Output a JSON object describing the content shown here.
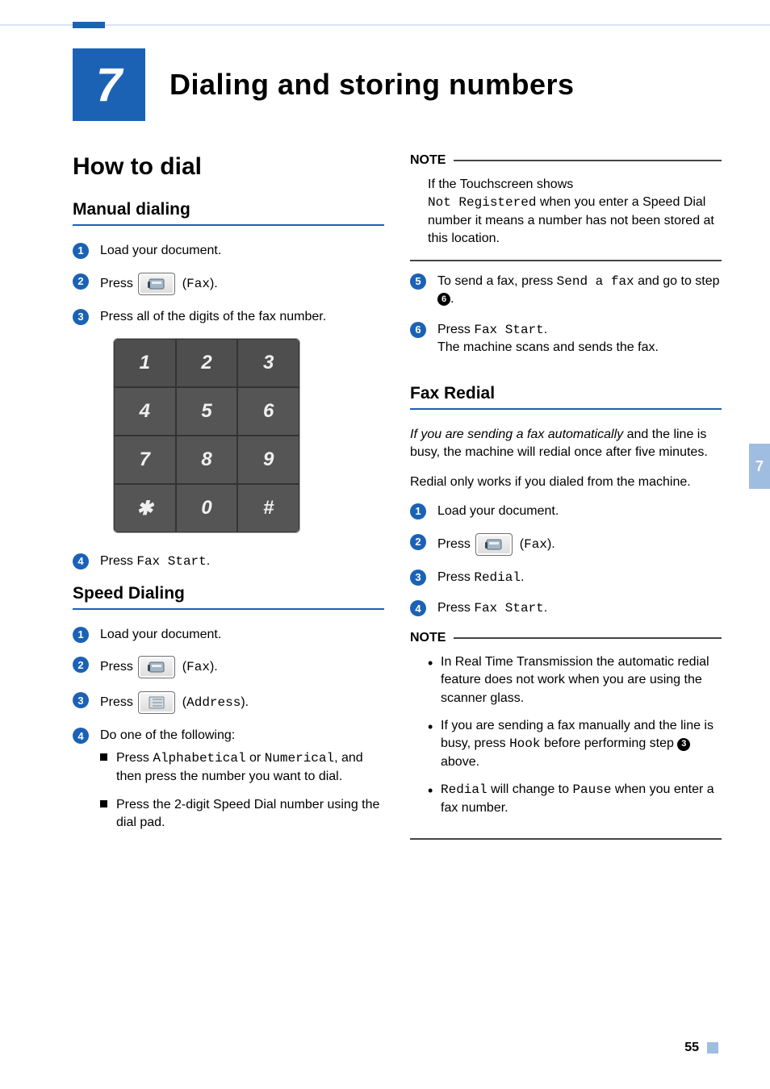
{
  "chapter": {
    "number": "7",
    "title": "Dialing and storing numbers"
  },
  "page": {
    "number": "55"
  },
  "badges": {
    "1": "1",
    "2": "2",
    "3": "3",
    "4": "4",
    "5": "5",
    "6": "6"
  },
  "keypad": [
    "1",
    "2",
    "3",
    "4",
    "5",
    "6",
    "7",
    "8",
    "9",
    "✱",
    "0",
    "#"
  ],
  "left": {
    "section_title": "How to dial",
    "manual": {
      "heading": "Manual dialing",
      "step1": "Load your document.",
      "step2_pre": "Press ",
      "step2_fax": "Fax",
      "step3": "Press all of the digits of the fax number.",
      "step4_pre": "Press ",
      "step4_cmd": "Fax Start"
    },
    "speed": {
      "heading": "Speed Dialing",
      "step1": "Load your document.",
      "step2_pre": "Press ",
      "step2_fax": "Fax",
      "step3_pre": "Press ",
      "step3_addr": "Address",
      "step4_intro": "Do one of the following:",
      "opt_a_1": "Press ",
      "opt_a_alpha": "Alphabetical",
      "opt_a_or": " or ",
      "opt_a_num": "Numerical",
      "opt_a_2": ", and then press the number you want to dial.",
      "opt_b": "Press the 2-digit Speed Dial number using the dial pad."
    }
  },
  "right": {
    "note1": {
      "label": "NOTE",
      "line1": "If the Touchscreen shows",
      "mono": "Not Registered",
      "line2": " when you enter a Speed Dial number it means a number has not been stored at this location."
    },
    "step5_pre": "To send a fax, press ",
    "step5_cmd": "Send a fax",
    "step5_mid": " and go to step ",
    "step6_pre": "Press ",
    "step6_cmd": "Fax Start",
    "step6_post": "The machine scans and sends the fax.",
    "redial": {
      "heading": "Fax Redial",
      "p1_italic": "If you are sending a fax automatically",
      "p1_rest": " and the line is busy, the machine will redial once after five minutes.",
      "p2": "Redial only works if you dialed from the machine.",
      "step1": "Load your document.",
      "step2_pre": "Press ",
      "step2_fax": "Fax",
      "step3_pre": "Press ",
      "step3_cmd": "Redial",
      "step4_pre": "Press ",
      "step4_cmd": "Fax Start"
    },
    "note2": {
      "label": "NOTE",
      "b1": "In Real Time Transmission the automatic redial feature does not work when you are using the scanner glass.",
      "b2_pre": "If you are sending a fax manually and the line is busy, press ",
      "b2_hook": "Hook",
      "b2_mid": " before performing step ",
      "b2_post": " above.",
      "b3_redial": "Redial",
      "b3_mid": " will change to ",
      "b3_pause": "Pause",
      "b3_post": " when you enter a fax number."
    }
  }
}
